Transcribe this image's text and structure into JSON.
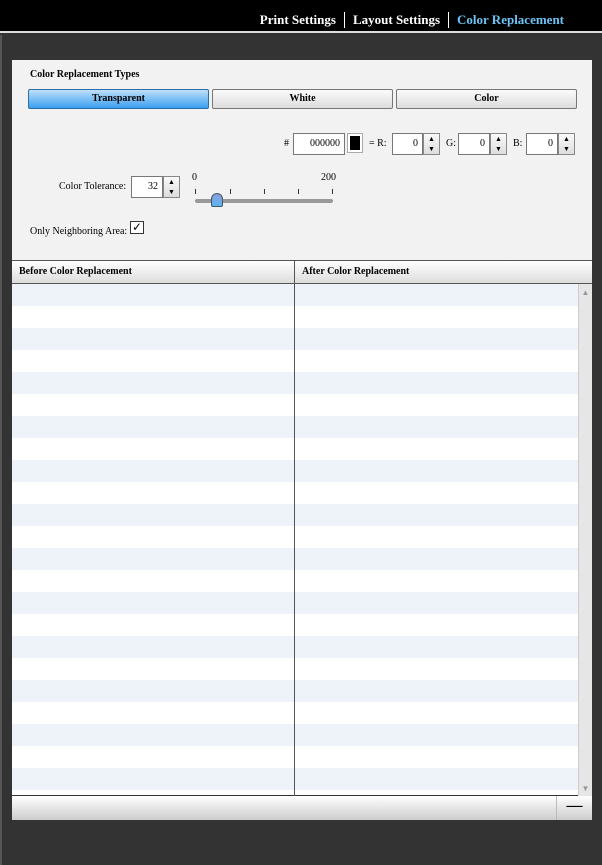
{
  "nav": {
    "tabs": [
      {
        "label": "Print Settings"
      },
      {
        "label": "Layout Settings"
      },
      {
        "label": "Color Replacement",
        "active": true
      }
    ]
  },
  "panel": {
    "title": "Color Replacement Types",
    "types": [
      {
        "label": "Transparent",
        "selected": true
      },
      {
        "label": "White"
      },
      {
        "label": "Color"
      }
    ],
    "hash_label": "#",
    "hex_value": "000000",
    "swatch_color": "#000000",
    "eq_r_label": "= R:",
    "r_value": "0",
    "g_label": "G:",
    "g_value": "0",
    "b_label": "B:",
    "b_value": "0",
    "tolerance_label": "Color Tolerance:",
    "tolerance_value": "32",
    "slider": {
      "min_label": "0",
      "max_label": "200",
      "value": 32,
      "min": 0,
      "max": 200
    },
    "neighbor_label": "Only Neighboring Area:",
    "neighbor_checked": true
  },
  "table": {
    "columns": [
      "Before Color Replacement",
      "After Color Replacement"
    ],
    "rows": []
  },
  "accent": "#3a9ff0",
  "active_tab_color": "#6ec3f5"
}
